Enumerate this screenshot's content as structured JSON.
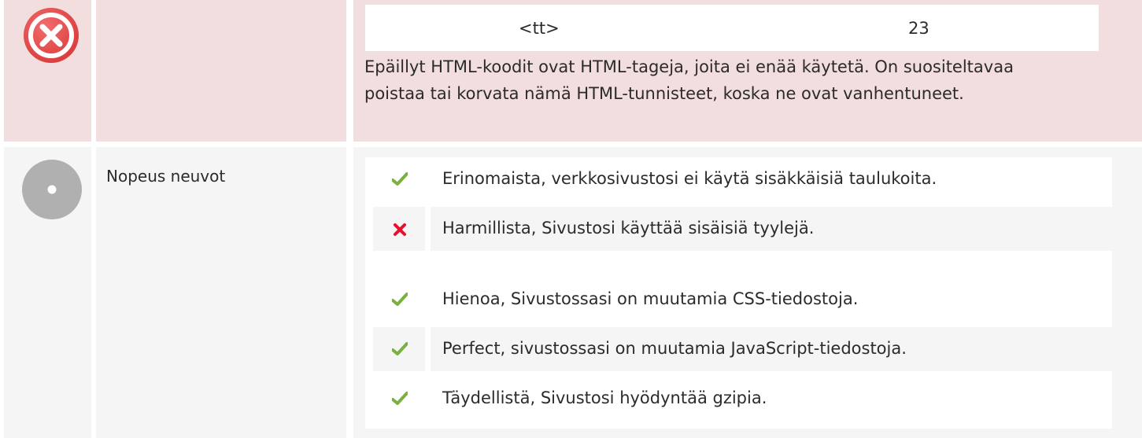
{
  "colors": {
    "error_row_bg": "#f2dede",
    "neutral_row_bg": "#f5f5f5",
    "check": "#78b13f",
    "cross": "#e8112d",
    "error_icon": "#e14a4a",
    "neutral_icon": "#b0b0b0"
  },
  "error_row": {
    "icon": "error-circle-icon",
    "tag_table": {
      "tag": "<tt>",
      "count": "23"
    },
    "description": "Epäillyt HTML-koodit ovat HTML-tageja, joita ei enää käytetä. On suositeltavaa poistaa tai korvata nämä HTML-tunnisteet, koska ne ovat vanhentuneet."
  },
  "speed_row": {
    "icon": "neutral-circle-icon",
    "label": "Nopeus neuvot",
    "tips": [
      {
        "status": "check",
        "text": "Erinomaista, verkkosivustosi ei käytä sisäkkäisiä taulukoita."
      },
      {
        "status": "cross",
        "text": "Harmillista, Sivustosi käyttää sisäisiä tyylejä."
      },
      {
        "status": "check",
        "text": "Hienoa, Sivustossasi on muutamia CSS-tiedostoja."
      },
      {
        "status": "check",
        "text": "Perfect, sivustossasi on muutamia JavaScript-tiedostoja."
      },
      {
        "status": "check",
        "text": "Täydellistä, Sivustosi hyödyntää gzipia."
      }
    ]
  }
}
